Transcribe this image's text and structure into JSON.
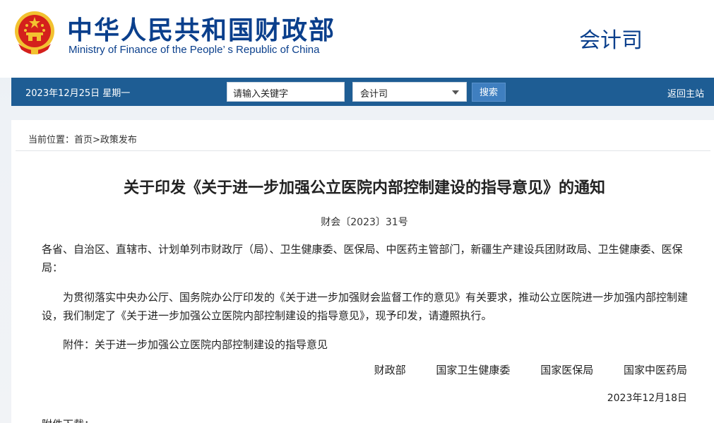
{
  "header": {
    "title_cn": "中华人民共和国财政部",
    "title_en": "Ministry of Finance of the People’ s Republic of China",
    "department": "会计司"
  },
  "navbar": {
    "date": "2023年12月25日  星期一",
    "search_placeholder": "请输入关键字",
    "scope_selected": "会计司",
    "search_button": "搜索",
    "home_link": "返回主站"
  },
  "breadcrumb": {
    "prefix": "当前位置：",
    "path": "首页>政策发布"
  },
  "article": {
    "title": "关于印发《关于进一步加强公立医院内部控制建设的指导意见》的通知",
    "doc_number": "财会〔2023〕31号",
    "addressees": "各省、自治区、直辖市、计划单列市财政厅（局）、卫生健康委、医保局、中医药主管部门，新疆生产建设兵团财政局、卫生健康委、医保局：",
    "body": "为贯彻落实中央办公厅、国务院办公厅印发的《关于进一步加强财会监督工作的意见》有关要求，推动公立医院进一步加强内部控制建设，我们制定了《关于进一步加强公立医院内部控制建设的指导意见》，现予印发，请遵照执行。",
    "attachment": "附件：关于进一步加强公立医院内部控制建设的指导意见",
    "signers": [
      "财政部",
      "国家卫生健康委",
      "国家医保局",
      "国家中医药局"
    ],
    "date": "2023年12月18日",
    "download_label": "附件下载："
  },
  "colors": {
    "brand_blue": "#0a3f8c",
    "nav_bar": "#1e5d94",
    "search_button": "#3f7fc0",
    "emblem_red": "#d4201c",
    "emblem_gold": "#f2c230"
  }
}
